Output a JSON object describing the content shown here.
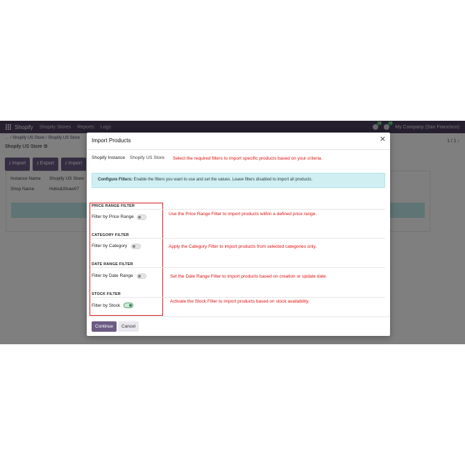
{
  "topbar": {
    "brand": "Shopify",
    "menu": [
      "Shopify Stores",
      "Reports",
      "Logs"
    ],
    "badges": [
      "28",
      "24"
    ],
    "company": "My Company (San Francisco)"
  },
  "breadcrumb": {
    "items": [
      "Shopify US Store",
      "Shopify US Store"
    ],
    "current": "Shopify US Store"
  },
  "pager": "1 / 1",
  "actions": [
    "Import",
    "Export",
    "Import"
  ],
  "sheet": {
    "instance_label": "Instance Name",
    "instance_value": "Shopify US Store",
    "shop_label": "Shop Name",
    "shop_value": "Hobs&Shaw07"
  },
  "dialog": {
    "title": "Import Products",
    "instance_label": "Shopify Instance",
    "instance_value": "Shopify US Store",
    "note_instance": "Select the required filters to import specific products based on your criteria.",
    "info_bold": "Configure Filters:",
    "info_text": " Enable the filters you want to use and set the values. Leave filters disabled to import all products.",
    "sections": [
      {
        "header": "PRICE RANGE FILTER",
        "label": "Filter by Price Range",
        "enabled": false,
        "note": "Use the Price Range Filter to import products within a defined price range."
      },
      {
        "header": "CATEGORY FILTER",
        "label": "Filter by Category",
        "enabled": false,
        "note": "Apply the Category Filter to import products from selected categories only."
      },
      {
        "header": "DATE RANGE FILTER",
        "label": "Filter by Date Range",
        "enabled": false,
        "note": "Set the Date Range Filter to import products based on creation or update date."
      },
      {
        "header": "STOCK FILTER",
        "label": "Filter by Stock",
        "enabled": true,
        "note": "Activate the Stock Filter to import products based on stock availability."
      }
    ],
    "continue_label": "Continue",
    "cancel_label": "Cancel"
  }
}
